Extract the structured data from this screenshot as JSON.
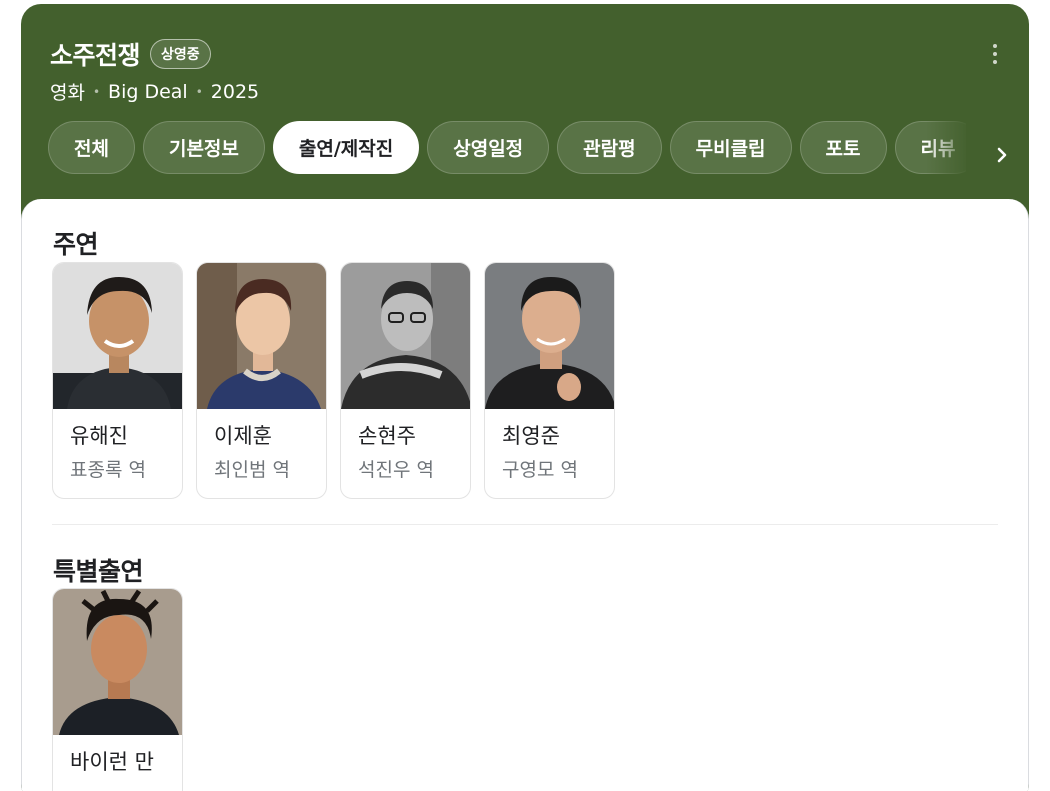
{
  "header": {
    "title": "소주전쟁",
    "badge": "상영중",
    "meta": [
      "영화",
      "Big Deal",
      "2025"
    ],
    "more_icon": "more-vert-icon",
    "bg_color": "#43602d"
  },
  "tabs": [
    {
      "label": "전체",
      "active": false
    },
    {
      "label": "기본정보",
      "active": false
    },
    {
      "label": "출연/제작진",
      "active": true
    },
    {
      "label": "상영일정",
      "active": false
    },
    {
      "label": "관람평",
      "active": false
    },
    {
      "label": "무비클립",
      "active": false
    },
    {
      "label": "포토",
      "active": false
    },
    {
      "label": "리뷰",
      "active": false
    }
  ],
  "tabs_next_icon": "chevron-right-icon",
  "sections": {
    "main_cast": {
      "title": "주연",
      "people": [
        {
          "name": "유해진",
          "role": "표종록 역"
        },
        {
          "name": "이제훈",
          "role": "최인범 역"
        },
        {
          "name": "손현주",
          "role": "석진우 역"
        },
        {
          "name": "최영준",
          "role": "구영모 역"
        }
      ]
    },
    "special_appearance": {
      "title": "특별출연",
      "people": [
        {
          "name": "바이런 만",
          "role": ""
        }
      ]
    }
  }
}
